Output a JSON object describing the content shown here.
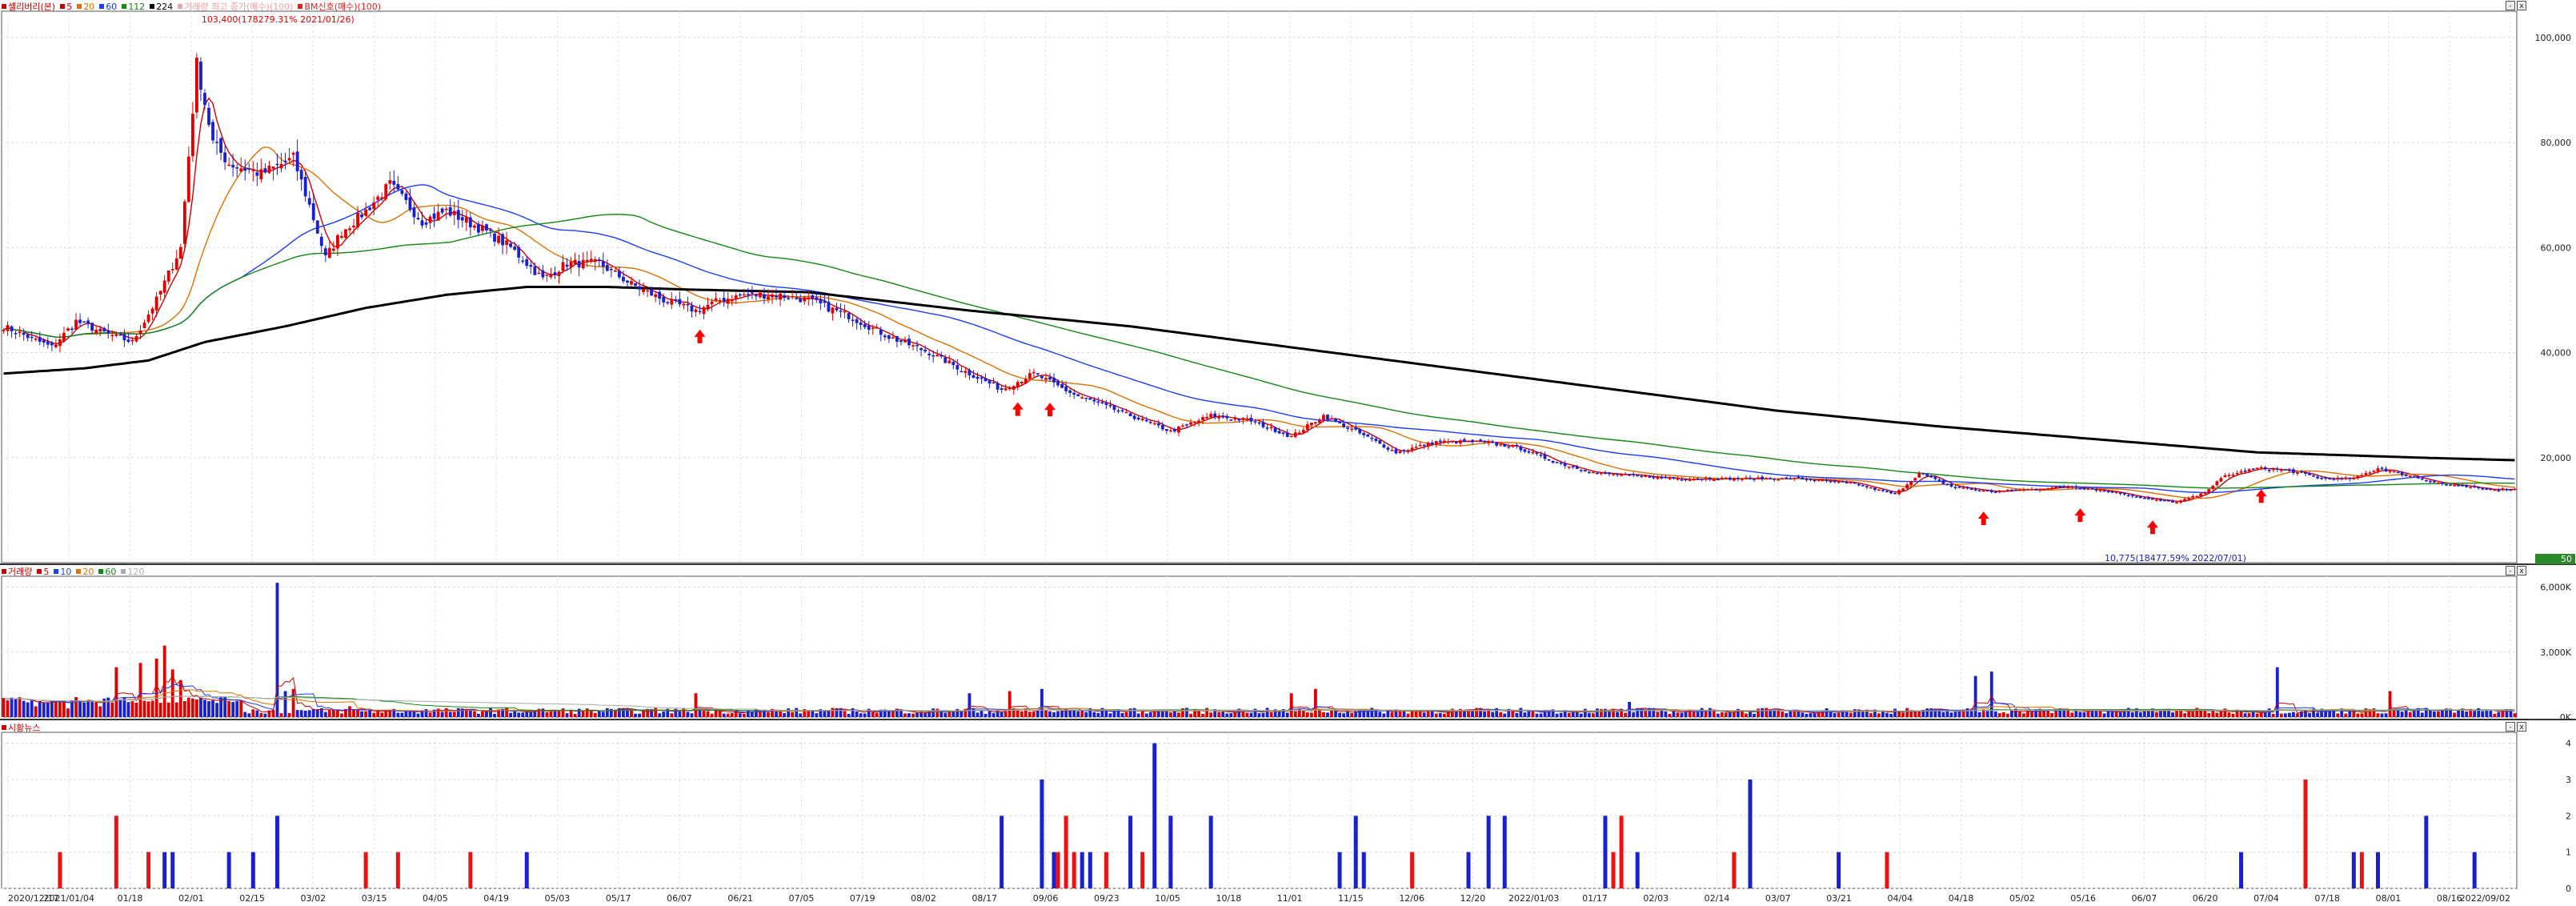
{
  "panels": {
    "price": {
      "legend": [
        {
          "label": "셀리버리(본)",
          "color": "#cc0000"
        },
        {
          "label": "5",
          "color": "#d00000"
        },
        {
          "label": "20",
          "color": "#e07000"
        },
        {
          "label": "60",
          "color": "#1a3cff"
        },
        {
          "label": "112",
          "color": "#118811"
        },
        {
          "label": "224",
          "color": "#000000"
        },
        {
          "label": "거래량 최고 종가(매수)(100)",
          "color": "#f0a0a0"
        },
        {
          "label": "BM신호(매수)(100)",
          "color": "#dd2222"
        }
      ],
      "annotation_high": "103,400(178279.31% 2021/01/26)",
      "annotation_low": "10,775(18477.59% 2022/07/01)",
      "current_value_badge": "50"
    },
    "volume": {
      "legend": [
        {
          "label": "거래량",
          "color": "#cc0000"
        },
        {
          "label": "5",
          "color": "#d00000"
        },
        {
          "label": "10",
          "color": "#1a3cff"
        },
        {
          "label": "20",
          "color": "#e07000"
        },
        {
          "label": "60",
          "color": "#118811"
        },
        {
          "label": "120",
          "color": "#aaaaaa"
        }
      ]
    },
    "news": {
      "legend": [
        {
          "label": "시황뉴스",
          "color": "#cc0000"
        }
      ]
    }
  },
  "window_buttons": [
    "-",
    "x"
  ],
  "chart_data": [
    {
      "type": "candlestick",
      "title": "셀리버리(본)",
      "x_tick_labels": [
        "2020/12/17",
        "2021/01/04",
        "01/18",
        "02/01",
        "02/15",
        "03/02",
        "03/15",
        "04/05",
        "04/19",
        "05/03",
        "05/17",
        "06/07",
        "06/21",
        "07/05",
        "07/19",
        "08/02",
        "08/17",
        "09/06",
        "09/23",
        "10/05",
        "10/18",
        "11/01",
        "11/15",
        "12/06",
        "12/20",
        "2022/01/03",
        "01/17",
        "02/03",
        "02/14",
        "03/07",
        "03/21",
        "04/04",
        "04/18",
        "05/02",
        "05/16",
        "06/07",
        "06/20",
        "07/04",
        "07/18",
        "08/01",
        "08/16",
        "2022/09/02"
      ],
      "ylim": [
        0,
        105000
      ],
      "y_ticks": [
        {
          "v": 20000,
          "label": "20,000"
        },
        {
          "v": 40000,
          "label": "40,000"
        },
        {
          "v": 60000,
          "label": "60,000"
        },
        {
          "v": 80000,
          "label": "80,000"
        },
        {
          "v": 100000,
          "label": "100,000"
        }
      ],
      "close_keypoints": [
        [
          0,
          45000
        ],
        [
          12,
          41000
        ],
        [
          18,
          46000
        ],
        [
          24,
          44000
        ],
        [
          32,
          42000
        ],
        [
          38,
          50000
        ],
        [
          44,
          60000
        ],
        [
          48,
          95000
        ],
        [
          52,
          80000
        ],
        [
          56,
          76000
        ],
        [
          64,
          74000
        ],
        [
          72,
          77000
        ],
        [
          76,
          68000
        ],
        [
          80,
          58000
        ],
        [
          84,
          63000
        ],
        [
          90,
          67000
        ],
        [
          96,
          72000
        ],
        [
          104,
          65000
        ],
        [
          110,
          67000
        ],
        [
          120,
          63000
        ],
        [
          126,
          60000
        ],
        [
          134,
          54000
        ],
        [
          140,
          57000
        ],
        [
          148,
          57000
        ],
        [
          156,
          53000
        ],
        [
          164,
          50000
        ],
        [
          172,
          48000
        ],
        [
          178,
          50000
        ],
        [
          184,
          51000
        ],
        [
          192,
          51000
        ],
        [
          200,
          50000
        ],
        [
          210,
          47000
        ],
        [
          220,
          43000
        ],
        [
          230,
          40000
        ],
        [
          240,
          36000
        ],
        [
          248,
          33000
        ],
        [
          256,
          36000
        ],
        [
          266,
          32000
        ],
        [
          280,
          28000
        ],
        [
          290,
          25000
        ],
        [
          300,
          28000
        ],
        [
          310,
          27000
        ],
        [
          320,
          24000
        ],
        [
          328,
          28000
        ],
        [
          336,
          25000
        ],
        [
          346,
          21000
        ],
        [
          356,
          23000
        ],
        [
          366,
          23000
        ],
        [
          376,
          22000
        ],
        [
          386,
          19000
        ],
        [
          396,
          17000
        ],
        [
          406,
          16500
        ],
        [
          416,
          16000
        ],
        [
          430,
          16000
        ],
        [
          446,
          16000
        ],
        [
          460,
          15000
        ],
        [
          470,
          13000
        ],
        [
          476,
          17000
        ],
        [
          484,
          14500
        ],
        [
          494,
          13500
        ],
        [
          504,
          14000
        ],
        [
          514,
          14500
        ],
        [
          524,
          13500
        ],
        [
          534,
          12000
        ],
        [
          540,
          11500
        ],
        [
          546,
          13000
        ],
        [
          552,
          16500
        ],
        [
          560,
          18000
        ],
        [
          568,
          17500
        ],
        [
          576,
          16000
        ],
        [
          584,
          16000
        ],
        [
          590,
          18000
        ],
        [
          598,
          16500
        ],
        [
          606,
          15000
        ],
        [
          616,
          14000
        ],
        [
          624,
          14000
        ]
      ],
      "ma_series": [
        {
          "name": "5",
          "color": "#d00000",
          "window": 5
        },
        {
          "name": "20",
          "color": "#e07000",
          "window": 20
        },
        {
          "name": "60",
          "color": "#1a3cff",
          "window": 60
        },
        {
          "name": "112",
          "color": "#118811",
          "window": 112
        },
        {
          "name": "224",
          "color": "#000000",
          "window": 224
        }
      ],
      "ma_224_keypoints": [
        [
          0,
          36000
        ],
        [
          20,
          37000
        ],
        [
          36,
          38500
        ],
        [
          50,
          42000
        ],
        [
          70,
          45000
        ],
        [
          90,
          48500
        ],
        [
          110,
          51000
        ],
        [
          130,
          52500
        ],
        [
          150,
          52500
        ],
        [
          170,
          52000
        ],
        [
          200,
          51500
        ],
        [
          240,
          48000
        ],
        [
          280,
          45000
        ],
        [
          320,
          41000
        ],
        [
          360,
          37000
        ],
        [
          400,
          33000
        ],
        [
          440,
          29000
        ],
        [
          480,
          26000
        ],
        [
          520,
          23500
        ],
        [
          560,
          21000
        ],
        [
          600,
          20000
        ],
        [
          624,
          19500
        ]
      ],
      "signal_markers": [
        {
          "x": 173
        },
        {
          "x": 252
        },
        {
          "x": 260
        },
        {
          "x": 492
        },
        {
          "x": 516
        },
        {
          "x": 534
        },
        {
          "x": 561
        }
      ]
    },
    {
      "type": "bar",
      "title": "거래량",
      "ylim": [
        0,
        6500
      ],
      "y_ticks": [
        {
          "v": 0,
          "label": "0K"
        },
        {
          "v": 3000,
          "label": "3,000K"
        },
        {
          "v": 6000,
          "label": "6,000K"
        }
      ],
      "spikes": [
        [
          2,
          900
        ],
        [
          8,
          500
        ],
        [
          16,
          400
        ],
        [
          24,
          500
        ],
        [
          28,
          2300
        ],
        [
          34,
          2500
        ],
        [
          38,
          2700
        ],
        [
          40,
          3300
        ],
        [
          42,
          2200
        ],
        [
          44,
          1700
        ],
        [
          46,
          900
        ],
        [
          68,
          6200
        ],
        [
          70,
          1200
        ],
        [
          72,
          1300
        ],
        [
          86,
          500
        ],
        [
          172,
          1100
        ],
        [
          240,
          1100
        ],
        [
          250,
          1200
        ],
        [
          258,
          1300
        ],
        [
          320,
          1100
        ],
        [
          326,
          1300
        ],
        [
          404,
          700
        ],
        [
          490,
          1900
        ],
        [
          494,
          2100
        ],
        [
          565,
          2300
        ],
        [
          593,
          1200
        ]
      ]
    },
    {
      "type": "bar",
      "title": "시황뉴스",
      "ylim": [
        0,
        4.3
      ],
      "y_ticks": [
        {
          "v": 0,
          "label": "0"
        },
        {
          "v": 1,
          "label": "1"
        },
        {
          "v": 2,
          "label": "2"
        },
        {
          "v": 3,
          "label": "3"
        },
        {
          "v": 4,
          "label": "4"
        }
      ],
      "events": [
        [
          14,
          1,
          "r"
        ],
        [
          28,
          2,
          "r"
        ],
        [
          36,
          1,
          "r"
        ],
        [
          40,
          1,
          "b"
        ],
        [
          42,
          1,
          "b"
        ],
        [
          56,
          1,
          "b"
        ],
        [
          62,
          1,
          "b"
        ],
        [
          68,
          2,
          "b"
        ],
        [
          90,
          1,
          "r"
        ],
        [
          98,
          1,
          "r"
        ],
        [
          116,
          1,
          "r"
        ],
        [
          130,
          1,
          "b"
        ],
        [
          248,
          2,
          "b"
        ],
        [
          258,
          3,
          "b"
        ],
        [
          261,
          1,
          "b"
        ],
        [
          262,
          1,
          "r"
        ],
        [
          264,
          2,
          "r"
        ],
        [
          266,
          1,
          "r"
        ],
        [
          268,
          1,
          "b"
        ],
        [
          270,
          1,
          "b"
        ],
        [
          274,
          1,
          "r"
        ],
        [
          280,
          2,
          "b"
        ],
        [
          283,
          1,
          "r"
        ],
        [
          286,
          4,
          "b"
        ],
        [
          290,
          2,
          "b"
        ],
        [
          300,
          2,
          "b"
        ],
        [
          332,
          1,
          "b"
        ],
        [
          336,
          2,
          "b"
        ],
        [
          338,
          1,
          "b"
        ],
        [
          350,
          1,
          "r"
        ],
        [
          364,
          1,
          "b"
        ],
        [
          369,
          2,
          "b"
        ],
        [
          373,
          2,
          "b"
        ],
        [
          398,
          2,
          "b"
        ],
        [
          400,
          1,
          "r"
        ],
        [
          402,
          2,
          "r"
        ],
        [
          406,
          1,
          "b"
        ],
        [
          430,
          1,
          "r"
        ],
        [
          434,
          3,
          "b"
        ],
        [
          456,
          1,
          "b"
        ],
        [
          468,
          1,
          "r"
        ],
        [
          556,
          1,
          "b"
        ],
        [
          572,
          3,
          "r"
        ],
        [
          584,
          1,
          "b"
        ],
        [
          586,
          1,
          "r"
        ],
        [
          590,
          1,
          "b"
        ],
        [
          602,
          2,
          "b"
        ],
        [
          614,
          1,
          "b"
        ]
      ]
    }
  ]
}
